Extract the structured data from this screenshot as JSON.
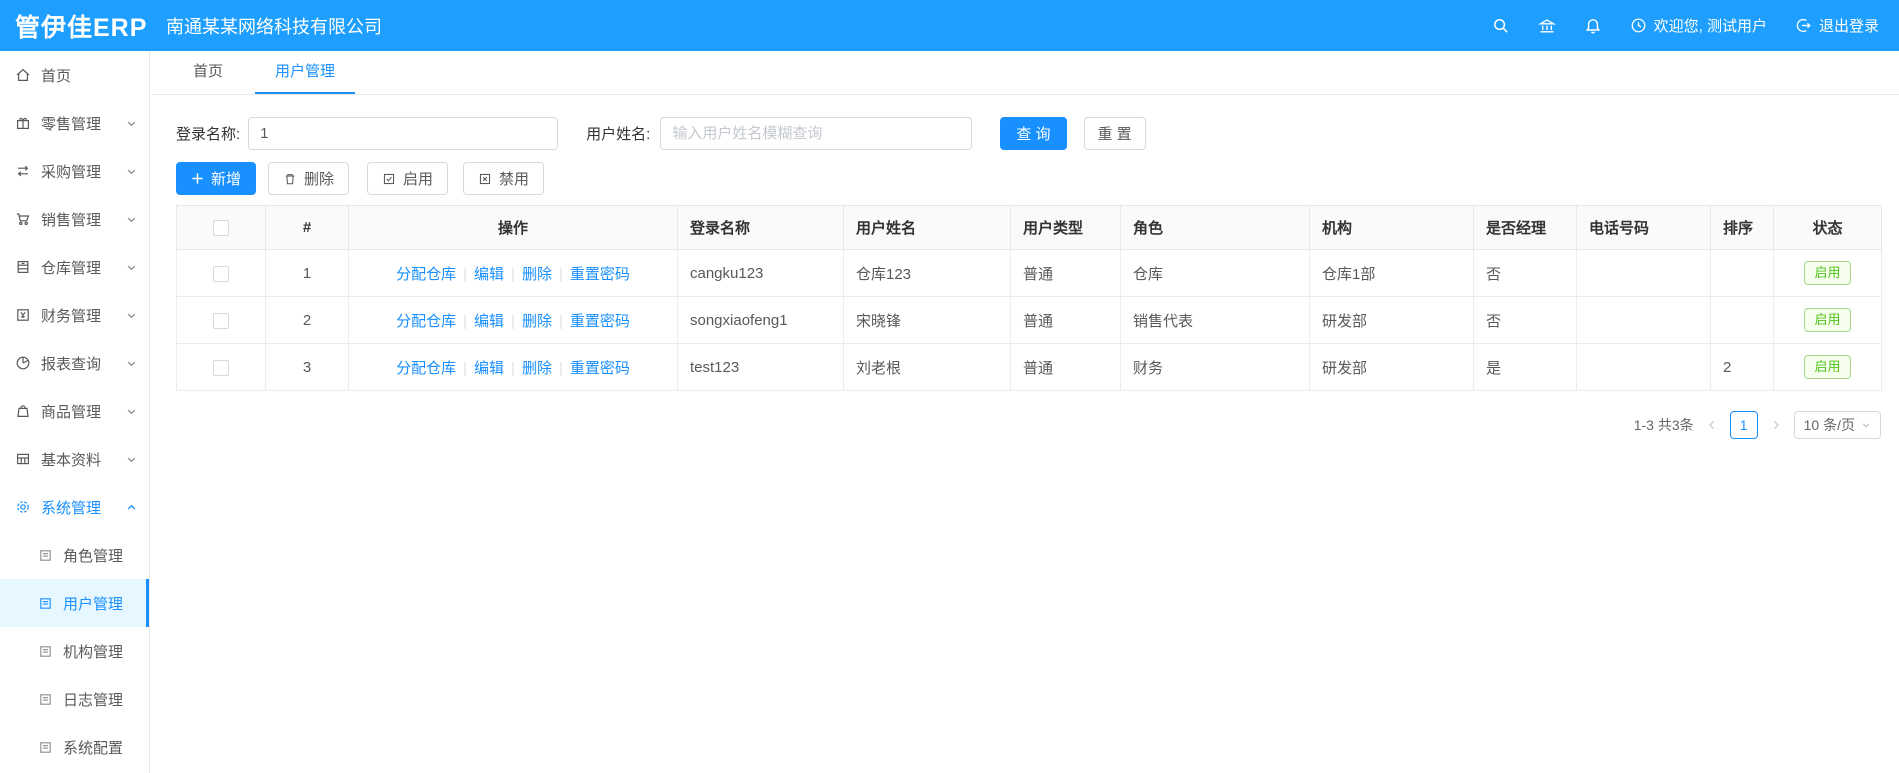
{
  "colors": {
    "header_bg": "#1e9fff",
    "accent": "#1890ff",
    "status_on_green": "#52c41a",
    "active_menu_bg": "#e6f7ff"
  },
  "header": {
    "logo": "管伊佳ERP",
    "company": "南通某某网络科技有限公司",
    "welcome": "欢迎您, 测试用户",
    "logout": "退出登录"
  },
  "sidebar": {
    "items": [
      {
        "label": "首页"
      },
      {
        "label": "零售管理"
      },
      {
        "label": "采购管理"
      },
      {
        "label": "销售管理"
      },
      {
        "label": "仓库管理"
      },
      {
        "label": "财务管理"
      },
      {
        "label": "报表查询"
      },
      {
        "label": "商品管理"
      },
      {
        "label": "基本资料"
      },
      {
        "label": "系统管理"
      }
    ],
    "system_children": [
      "角色管理",
      "用户管理",
      "机构管理",
      "日志管理",
      "系统配置"
    ]
  },
  "tabs": [
    "首页",
    "用户管理"
  ],
  "filters": {
    "login_label": "登录名称:",
    "login_value": "1",
    "name_label": "用户姓名:",
    "name_placeholder": "输入用户姓名模糊查询",
    "search_btn": "查 询",
    "reset_btn": "重 置"
  },
  "toolbar": {
    "add": "新增",
    "delete": "删除",
    "enable": "启用",
    "disable": "禁用"
  },
  "table": {
    "columns": [
      "#",
      "操作",
      "登录名称",
      "用户姓名",
      "用户类型",
      "角色",
      "机构",
      "是否经理",
      "电话号码",
      "排序",
      "状态"
    ],
    "op_labels": [
      "分配仓库",
      "编辑",
      "删除",
      "重置密码"
    ],
    "op_separator": "|",
    "rows": [
      {
        "index": "1",
        "login": "cangku123",
        "name": "仓库123",
        "type": "普通",
        "role": "仓库",
        "org": "仓库1部",
        "manager": "否",
        "phone": "",
        "sort": "",
        "status": "启用"
      },
      {
        "index": "2",
        "login": "songxiaofeng1",
        "name": "宋晓锋",
        "type": "普通",
        "role": "销售代表",
        "org": "研发部",
        "manager": "否",
        "phone": "",
        "sort": "",
        "status": "启用"
      },
      {
        "index": "3",
        "login": "test123",
        "name": "刘老根",
        "type": "普通",
        "role": "财务",
        "org": "研发部",
        "manager": "是",
        "phone": "",
        "sort": "2",
        "status": "启用"
      }
    ]
  },
  "pagination": {
    "total": "1-3 共3条",
    "page": "1",
    "page_size": "10 条/页"
  }
}
